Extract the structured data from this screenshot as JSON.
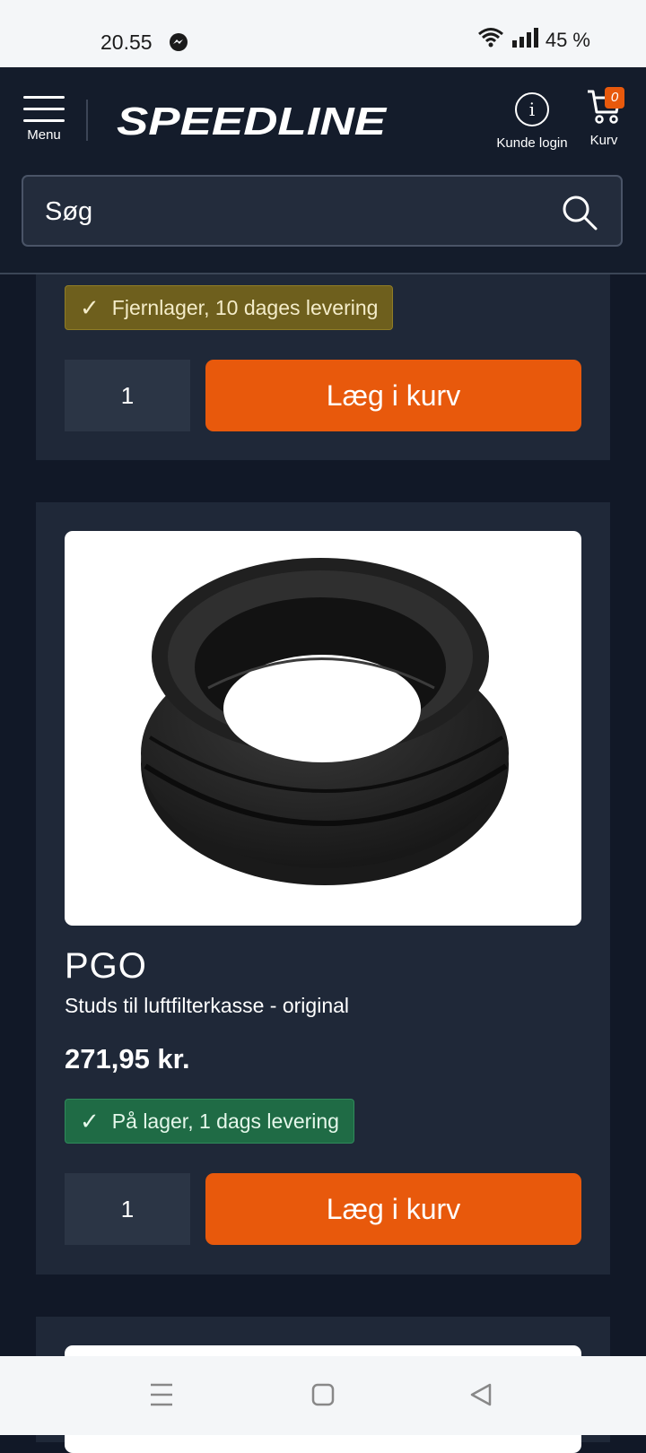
{
  "status": {
    "time": "20.55",
    "battery": "45 %"
  },
  "header": {
    "menu_label": "Menu",
    "logo_text": "SPEEDLINE",
    "login_label": "Kunde login",
    "cart_label": "Kurv",
    "cart_count": "0",
    "search_placeholder": "Søg"
  },
  "products": [
    {
      "stock_text": "Fjernlager, 10 dages levering",
      "stock_color": "#6e5f1d",
      "quantity": "1",
      "add_label": "Læg i kurv"
    },
    {
      "brand": "PGO",
      "description": "Studs til luftfilterkasse - original",
      "price": "271,95 kr.",
      "stock_text": "På lager, 1 dags levering",
      "stock_color": "#1f6b45",
      "quantity": "1",
      "add_label": "Læg i kurv"
    }
  ],
  "colors": {
    "accent": "#e8590c",
    "header_bg": "#141c2b",
    "card_bg": "#1f2838"
  },
  "icons": [
    "messenger-icon",
    "wifi-icon",
    "signal-icon",
    "menu-icon",
    "info-icon",
    "cart-icon",
    "search-icon",
    "check-icon",
    "nav-recents-icon",
    "nav-home-icon",
    "nav-back-icon"
  ]
}
